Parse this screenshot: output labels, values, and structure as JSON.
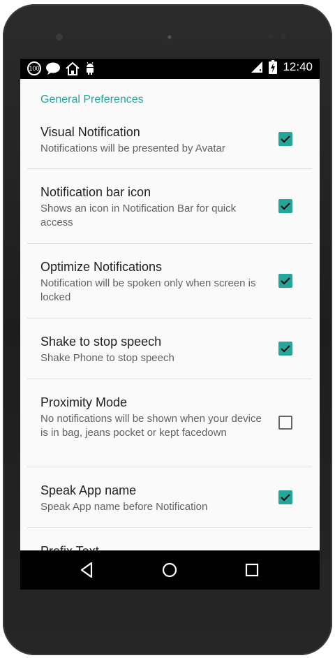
{
  "status_bar": {
    "time": "12:40",
    "badge_100": "100"
  },
  "screen": {
    "section_title": "General Preferences",
    "preferences": [
      {
        "title": "Visual Notification",
        "summary": "Notifications will be presented by Avatar",
        "checked": true
      },
      {
        "title": "Notification bar icon",
        "summary": "Shows an icon in Notification Bar for quick access",
        "checked": true
      },
      {
        "title": "Optimize Notifications",
        "summary": "Notification will be spoken only when screen is locked",
        "checked": true
      },
      {
        "title": "Shake to stop speech",
        "summary": "Shake Phone to stop speech",
        "checked": true
      },
      {
        "title": "Proximity Mode",
        "summary": "No notifications will be shown when your device is in bag, jeans pocket or kept facedown",
        "checked": false
      },
      {
        "title": "Speak App name",
        "summary": "Speak App name before Notification",
        "checked": true
      },
      {
        "title": "Prefix Text",
        "summary": "",
        "checked": null
      }
    ]
  },
  "colors": {
    "accent": "#26a69a",
    "background": "#fafafa",
    "title_text": "#212121",
    "summary_text": "#616161"
  }
}
